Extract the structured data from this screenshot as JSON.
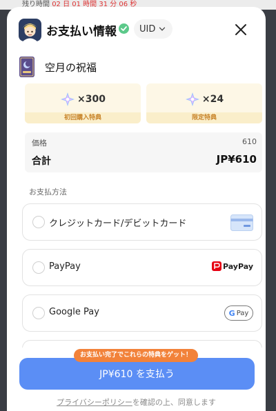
{
  "background": {
    "strip_text_prefix": "残り時間",
    "strip_text_value": "02 日 01 時間 31 分 06 秒"
  },
  "header": {
    "title": "お支払い情報",
    "uid_label": "UID",
    "app_icon": "game-character-icon",
    "verified_icon": "check-circle-icon",
    "close_icon": "close-icon"
  },
  "product": {
    "name": "空月の祝福",
    "thumb_icon": "welkin-card-icon"
  },
  "bonuses": [
    {
      "amount": "×300",
      "tag": "初回購入特典",
      "icon": "primogem-icon"
    },
    {
      "amount": "×24",
      "tag": "限定特典",
      "icon": "primogem-icon"
    }
  ],
  "price": {
    "price_label": "価格",
    "price_value": "610",
    "total_label": "合計",
    "total_value": "JP¥610"
  },
  "payment": {
    "section_label": "お支払方法",
    "methods": [
      {
        "label": "クレジットカード/デビットカード",
        "logo": "credit-card-icon"
      },
      {
        "label": "PayPay",
        "logo": "paypay-logo",
        "logo_text": "PayPay"
      },
      {
        "label": "Google Pay",
        "logo": "google-pay-logo",
        "logo_text": "Pay"
      }
    ]
  },
  "footer": {
    "promo_badge": "お支払い完了でこれらの特典をゲット！",
    "pay_button": "JP¥610 を支払う",
    "consent_link": "プライバシーポリシー",
    "consent_rest": "を確認の上、同意します"
  },
  "colors": {
    "accent": "#5b8ef5",
    "promo": "#f2823a",
    "bonus_bg": "#fdf7e6",
    "paypay_red": "#e60012"
  }
}
